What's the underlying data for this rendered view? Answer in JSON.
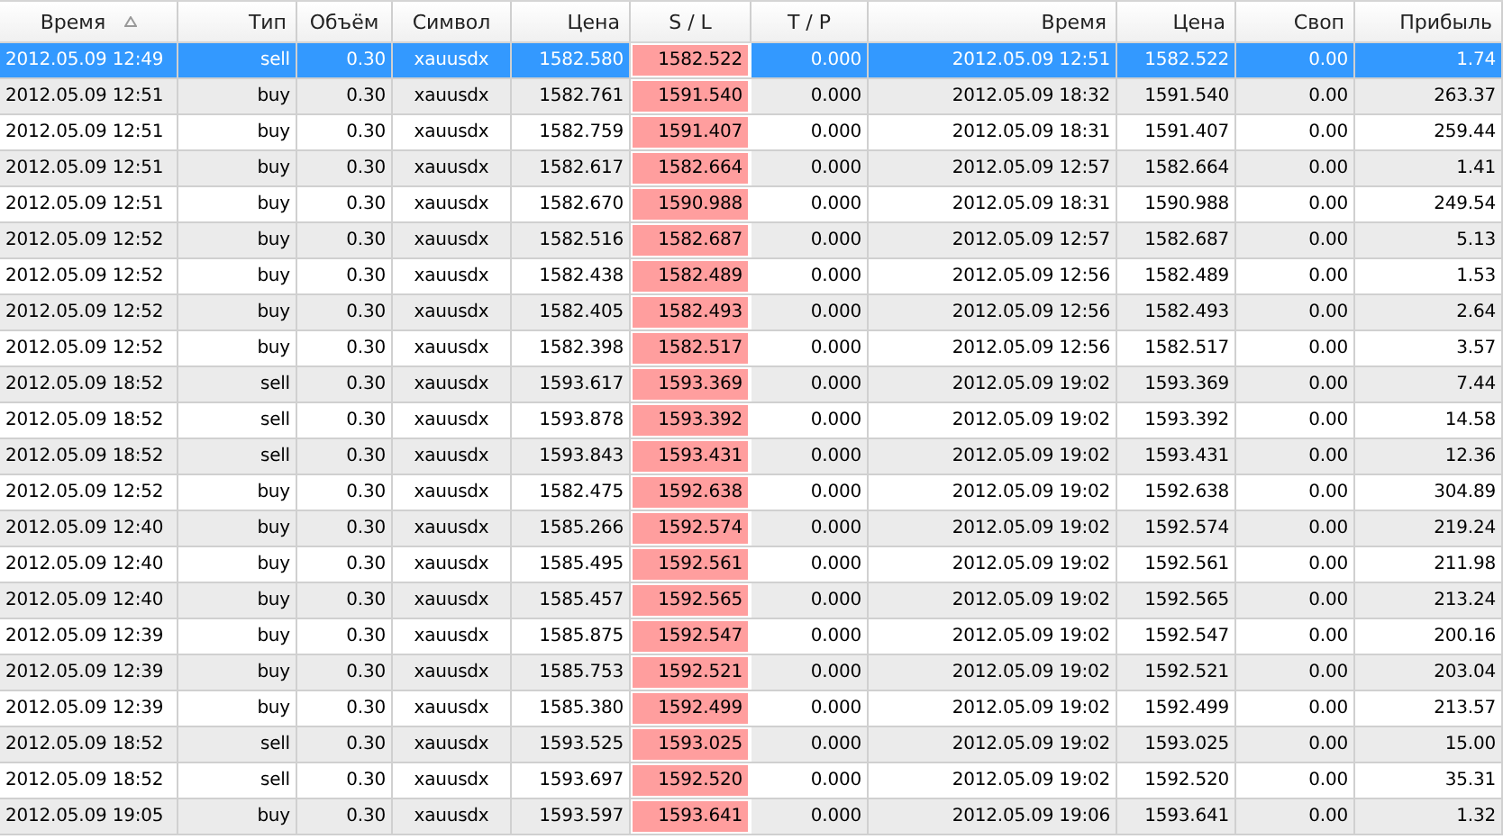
{
  "table": {
    "columns": [
      {
        "label": "Время",
        "sorted": true
      },
      {
        "label": "Тип",
        "sorted": false
      },
      {
        "label": "Объём",
        "sorted": false
      },
      {
        "label": "Символ",
        "sorted": false
      },
      {
        "label": "Цена",
        "sorted": false
      },
      {
        "label": "S / L",
        "sorted": false
      },
      {
        "label": "T / P",
        "sorted": false
      },
      {
        "label": "Время",
        "sorted": false
      },
      {
        "label": "Цена",
        "sorted": false
      },
      {
        "label": "Своп",
        "sorted": false
      },
      {
        "label": "Прибыль",
        "sorted": false
      }
    ],
    "rows": [
      {
        "selected": true,
        "cells": [
          "2012.05.09 12:49",
          "sell",
          "0.30",
          "xauusdx",
          "1582.580",
          "1582.522",
          "0.000",
          "2012.05.09 12:51",
          "1582.522",
          "0.00",
          "1.74"
        ]
      },
      {
        "selected": false,
        "cells": [
          "2012.05.09 12:51",
          "buy",
          "0.30",
          "xauusdx",
          "1582.761",
          "1591.540",
          "0.000",
          "2012.05.09 18:32",
          "1591.540",
          "0.00",
          "263.37"
        ]
      },
      {
        "selected": false,
        "cells": [
          "2012.05.09 12:51",
          "buy",
          "0.30",
          "xauusdx",
          "1582.759",
          "1591.407",
          "0.000",
          "2012.05.09 18:31",
          "1591.407",
          "0.00",
          "259.44"
        ]
      },
      {
        "selected": false,
        "cells": [
          "2012.05.09 12:51",
          "buy",
          "0.30",
          "xauusdx",
          "1582.617",
          "1582.664",
          "0.000",
          "2012.05.09 12:57",
          "1582.664",
          "0.00",
          "1.41"
        ]
      },
      {
        "selected": false,
        "cells": [
          "2012.05.09 12:51",
          "buy",
          "0.30",
          "xauusdx",
          "1582.670",
          "1590.988",
          "0.000",
          "2012.05.09 18:31",
          "1590.988",
          "0.00",
          "249.54"
        ]
      },
      {
        "selected": false,
        "cells": [
          "2012.05.09 12:52",
          "buy",
          "0.30",
          "xauusdx",
          "1582.516",
          "1582.687",
          "0.000",
          "2012.05.09 12:57",
          "1582.687",
          "0.00",
          "5.13"
        ]
      },
      {
        "selected": false,
        "cells": [
          "2012.05.09 12:52",
          "buy",
          "0.30",
          "xauusdx",
          "1582.438",
          "1582.489",
          "0.000",
          "2012.05.09 12:56",
          "1582.489",
          "0.00",
          "1.53"
        ]
      },
      {
        "selected": false,
        "cells": [
          "2012.05.09 12:52",
          "buy",
          "0.30",
          "xauusdx",
          "1582.405",
          "1582.493",
          "0.000",
          "2012.05.09 12:56",
          "1582.493",
          "0.00",
          "2.64"
        ]
      },
      {
        "selected": false,
        "cells": [
          "2012.05.09 12:52",
          "buy",
          "0.30",
          "xauusdx",
          "1582.398",
          "1582.517",
          "0.000",
          "2012.05.09 12:56",
          "1582.517",
          "0.00",
          "3.57"
        ]
      },
      {
        "selected": false,
        "cells": [
          "2012.05.09 18:52",
          "sell",
          "0.30",
          "xauusdx",
          "1593.617",
          "1593.369",
          "0.000",
          "2012.05.09 19:02",
          "1593.369",
          "0.00",
          "7.44"
        ]
      },
      {
        "selected": false,
        "cells": [
          "2012.05.09 18:52",
          "sell",
          "0.30",
          "xauusdx",
          "1593.878",
          "1593.392",
          "0.000",
          "2012.05.09 19:02",
          "1593.392",
          "0.00",
          "14.58"
        ]
      },
      {
        "selected": false,
        "cells": [
          "2012.05.09 18:52",
          "sell",
          "0.30",
          "xauusdx",
          "1593.843",
          "1593.431",
          "0.000",
          "2012.05.09 19:02",
          "1593.431",
          "0.00",
          "12.36"
        ]
      },
      {
        "selected": false,
        "cells": [
          "2012.05.09 12:52",
          "buy",
          "0.30",
          "xauusdx",
          "1582.475",
          "1592.638",
          "0.000",
          "2012.05.09 19:02",
          "1592.638",
          "0.00",
          "304.89"
        ]
      },
      {
        "selected": false,
        "cells": [
          "2012.05.09 12:40",
          "buy",
          "0.30",
          "xauusdx",
          "1585.266",
          "1592.574",
          "0.000",
          "2012.05.09 19:02",
          "1592.574",
          "0.00",
          "219.24"
        ]
      },
      {
        "selected": false,
        "cells": [
          "2012.05.09 12:40",
          "buy",
          "0.30",
          "xauusdx",
          "1585.495",
          "1592.561",
          "0.000",
          "2012.05.09 19:02",
          "1592.561",
          "0.00",
          "211.98"
        ]
      },
      {
        "selected": false,
        "cells": [
          "2012.05.09 12:40",
          "buy",
          "0.30",
          "xauusdx",
          "1585.457",
          "1592.565",
          "0.000",
          "2012.05.09 19:02",
          "1592.565",
          "0.00",
          "213.24"
        ]
      },
      {
        "selected": false,
        "cells": [
          "2012.05.09 12:39",
          "buy",
          "0.30",
          "xauusdx",
          "1585.875",
          "1592.547",
          "0.000",
          "2012.05.09 19:02",
          "1592.547",
          "0.00",
          "200.16"
        ]
      },
      {
        "selected": false,
        "cells": [
          "2012.05.09 12:39",
          "buy",
          "0.30",
          "xauusdx",
          "1585.753",
          "1592.521",
          "0.000",
          "2012.05.09 19:02",
          "1592.521",
          "0.00",
          "203.04"
        ]
      },
      {
        "selected": false,
        "cells": [
          "2012.05.09 12:39",
          "buy",
          "0.30",
          "xauusdx",
          "1585.380",
          "1592.499",
          "0.000",
          "2012.05.09 19:02",
          "1592.499",
          "0.00",
          "213.57"
        ]
      },
      {
        "selected": false,
        "cells": [
          "2012.05.09 18:52",
          "sell",
          "0.30",
          "xauusdx",
          "1593.525",
          "1593.025",
          "0.000",
          "2012.05.09 19:02",
          "1593.025",
          "0.00",
          "15.00"
        ]
      },
      {
        "selected": false,
        "cells": [
          "2012.05.09 18:52",
          "sell",
          "0.30",
          "xauusdx",
          "1593.697",
          "1592.520",
          "0.000",
          "2012.05.09 19:02",
          "1592.520",
          "0.00",
          "35.31"
        ]
      },
      {
        "selected": false,
        "cells": [
          "2012.05.09 19:05",
          "buy",
          "0.30",
          "xauusdx",
          "1593.597",
          "1593.641",
          "0.000",
          "2012.05.09 19:06",
          "1593.641",
          "0.00",
          "1.32"
        ]
      }
    ]
  }
}
